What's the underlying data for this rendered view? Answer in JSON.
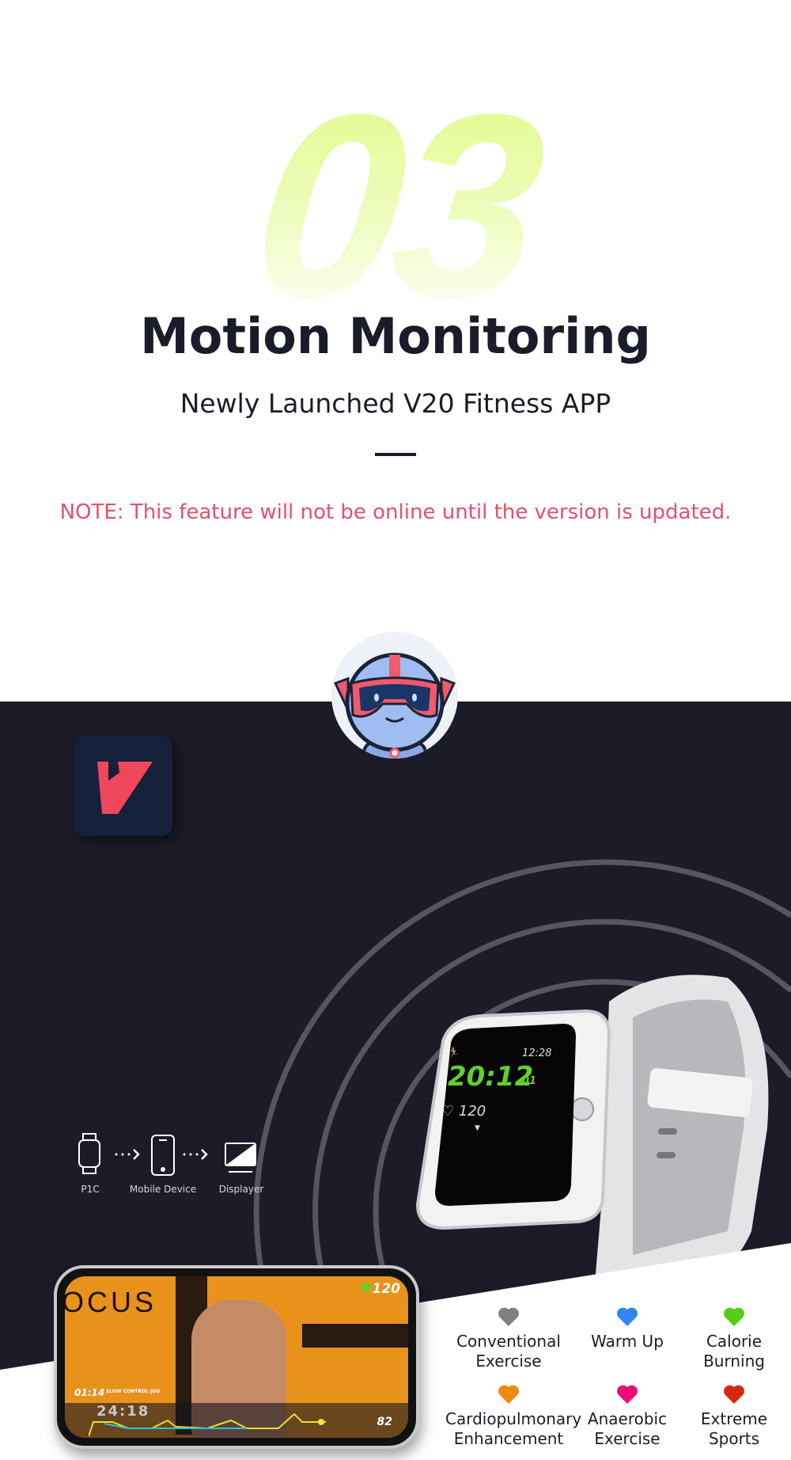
{
  "hero": {
    "number": "03",
    "title": "Motion Monitoring",
    "subtitle": "Newly Launched V20 Fitness APP",
    "note": "NOTE: This feature will not be online until the version is updated."
  },
  "colors": {
    "accent_green": "#e2fb86",
    "note_red": "#e6506a",
    "dark_bg": "#1b1c27",
    "app_icon_red": "#f0475c"
  },
  "watch": {
    "clock": "12:28",
    "timer": "20:12",
    "timer_seconds": "01",
    "heart_rate": "120"
  },
  "flow": {
    "items": [
      {
        "label": "P1C",
        "icon": "watch-icon"
      },
      {
        "label": "Mobile Device",
        "icon": "phone-icon"
      },
      {
        "label": "Displayer",
        "icon": "monitor-icon"
      }
    ]
  },
  "phone": {
    "heart_rate": "120",
    "brand_text": "OCUS",
    "move_time": "01:14",
    "move_name": "SLOW CONTROL JOG",
    "total_time": "24:18",
    "cadence": "82"
  },
  "zones": [
    {
      "label": "Conventional Exercise",
      "l1": "Conventional",
      "l2": "Exercise",
      "color": "#808080"
    },
    {
      "label": "Warm Up",
      "l1": "Warm Up",
      "l2": "",
      "color": "#2f86ec"
    },
    {
      "label": "Calorie Burning",
      "l1": "Calorie",
      "l2": "Burning",
      "color": "#58cc1a"
    },
    {
      "label": "Cardiopulmonary Enhancement",
      "l1": "Cardiopulmonary",
      "l2": "Enhancement",
      "color": "#f08814"
    },
    {
      "label": "Anaerobic Exercise",
      "l1": "Anaerobic",
      "l2": "Exercise",
      "color": "#ec0c7c"
    },
    {
      "label": "Extreme Sports",
      "l1": "Extreme",
      "l2": "Sports",
      "color": "#d8280c"
    }
  ]
}
